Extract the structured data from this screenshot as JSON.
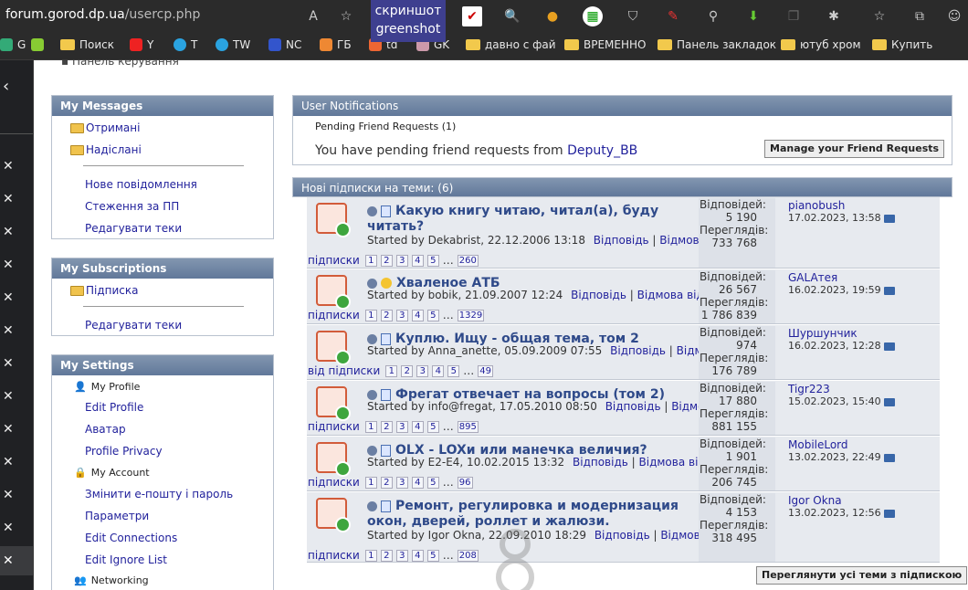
{
  "browser": {
    "url_host": "forum.gorod.dp.ua",
    "url_path": "/usercp.php",
    "greenshot_line1": "скриншот",
    "greenshot_line2": "greenshot"
  },
  "bookmarks": [
    {
      "label": "G"
    },
    {
      "label": ""
    },
    {
      "label": "Поиск"
    },
    {
      "label": "Y"
    },
    {
      "label": "T"
    },
    {
      "label": "TW"
    },
    {
      "label": "NC"
    },
    {
      "label": "ГБ"
    },
    {
      "label": "td"
    },
    {
      "label": "GK"
    },
    {
      "label": "давно с фай"
    },
    {
      "label": "ВРЕМЕННО"
    },
    {
      "label": "Панель закладок"
    },
    {
      "label": "ютуб хром"
    },
    {
      "label": "Купить"
    }
  ],
  "breadcrumb": "Панель керування",
  "my_messages": {
    "title": "My Messages",
    "inbox": "Отримані",
    "sent": "Надіслані",
    "new_message": "Нове повідомлення",
    "tracking": "Стеження за ПП",
    "edit_folders": "Редагувати теки"
  },
  "my_subscriptions": {
    "title": "My Subscriptions",
    "subscription": "Підписка",
    "edit_folders": "Редагувати теки"
  },
  "my_settings": {
    "title": "My Settings",
    "my_profile": "My Profile",
    "edit_profile": "Edit Profile",
    "avatar": "Аватар",
    "profile_privacy": "Profile Privacy",
    "my_account": "My Account",
    "change_email": "Змінити е-пошту і пароль",
    "options": "Параметри",
    "edit_connections": "Edit Connections",
    "edit_ignore": "Edit Ignore List",
    "networking": "Networking"
  },
  "notifications": {
    "title": "User Notifications",
    "pending": "Pending Friend Requests (1)",
    "text": "You have pending friend requests from",
    "user": "Deputy_BB",
    "button": "Manage your Friend Requests"
  },
  "subs_header": "Нові підписки на теми: (6)",
  "threads": [
    {
      "title1": "Какую книгу читаю, читал(а), буду",
      "title2": "читать?",
      "started": "Started by Dekabrist, 22.12.2006 13:18",
      "unsub": "Відповідь",
      "unsub2": "Відмова від",
      "unsub3": "підписки",
      "pages": [
        "1",
        "2",
        "3",
        "4",
        "5"
      ],
      "last_page": "260",
      "replies_label": "Відповідей:",
      "replies": "5 190",
      "views_label": "Переглядів:",
      "views": "733 768",
      "last_user": "pianobush",
      "last_date": "17.02.2023, 13:58"
    },
    {
      "title1": "Хваленое АТБ",
      "title2": "",
      "started": "Started by bobik, 21.09.2007 12:24",
      "unsub": "Відповідь",
      "unsub2": "Відмова від",
      "unsub3": "підписки",
      "pages": [
        "1",
        "2",
        "3",
        "4",
        "5"
      ],
      "last_page": "1329",
      "replies_label": "Відповідей:",
      "replies": "26 567",
      "views_label": "Переглядів:",
      "views": "1 786 839",
      "last_user": "GALAтея",
      "last_date": "16.02.2023, 19:59"
    },
    {
      "title1": "Куплю. Ищу - общая тема, том 2",
      "title2": "",
      "started": "Started by Anna_anette, 05.09.2009 07:55",
      "unsub": "Відповідь",
      "unsub2": "Відмова",
      "unsub3": "від підписки",
      "pages": [
        "1",
        "2",
        "3",
        "4",
        "5"
      ],
      "last_page": "49",
      "replies_label": "Відповідей:",
      "replies": "974",
      "views_label": "Переглядів:",
      "views": "176 789",
      "last_user": "Шуршунчик",
      "last_date": "16.02.2023, 12:28"
    },
    {
      "title1": "Фрегат отвечает на вопросы (том 2)",
      "title2": "",
      "started": "Started by info@fregat, 17.05.2010 08:50",
      "unsub": "Відповідь",
      "unsub2": "Відмова від",
      "unsub3": "підписки",
      "pages": [
        "1",
        "2",
        "3",
        "4",
        "5"
      ],
      "last_page": "895",
      "replies_label": "Відповідей:",
      "replies": "17 880",
      "views_label": "Переглядів:",
      "views": "881 155",
      "last_user": "Tigr223",
      "last_date": "15.02.2023, 15:40"
    },
    {
      "title1": "OLX - LOXи или манечка величия?",
      "title2": "",
      "started": "Started by E2-E4, 10.02.2015 13:32",
      "unsub": "Відповідь",
      "unsub2": "Відмова від",
      "unsub3": "підписки",
      "pages": [
        "1",
        "2",
        "3",
        "4",
        "5"
      ],
      "last_page": "96",
      "replies_label": "Відповідей:",
      "replies": "1 901",
      "views_label": "Переглядів:",
      "views": "206 745",
      "last_user": "MobileLord",
      "last_date": "13.02.2023, 22:49"
    },
    {
      "title1": "Ремонт, регулировка и модернизация",
      "title2": "окон, дверей, роллет и жалюзи.",
      "started": "Started by Igor Okna, 22.09.2010 18:29",
      "unsub": "Відповідь",
      "unsub2": "Відмова від",
      "unsub3": "підписки",
      "pages": [
        "1",
        "2",
        "3",
        "4",
        "5"
      ],
      "last_page": "208",
      "replies_label": "Відповідей:",
      "replies": "4 153",
      "views_label": "Переглядів:",
      "views": "318 495",
      "last_user": "Igor Okna",
      "last_date": "13.02.2023, 12:56"
    }
  ],
  "view_all": "Переглянути усі теми з підпискою"
}
